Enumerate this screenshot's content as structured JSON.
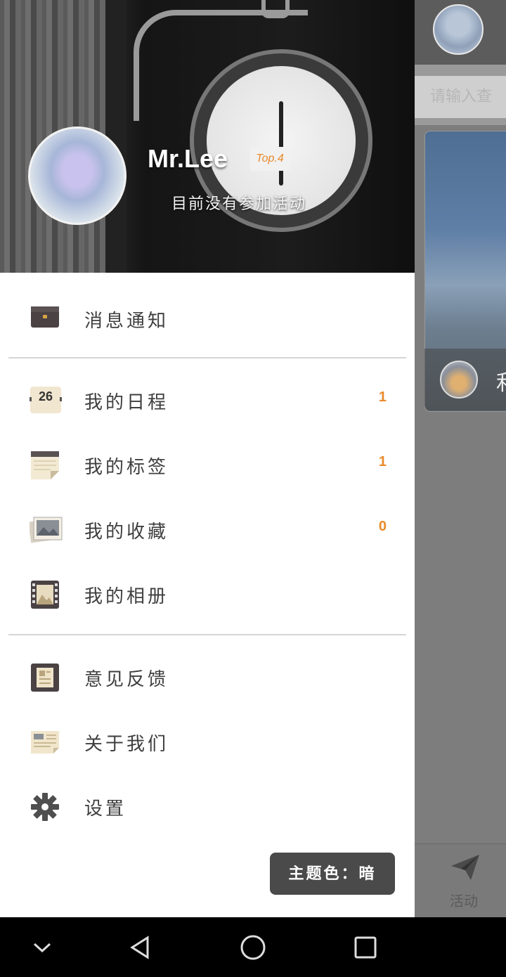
{
  "profile": {
    "username": "Mr.Lee",
    "rank_badge": "Top.4",
    "status": "目前没有参加活动"
  },
  "menu": {
    "section1": [
      {
        "label": "消息通知",
        "icon": "briefcase-icon"
      }
    ],
    "section2": [
      {
        "label": "我的日程",
        "icon": "calendar-icon",
        "calendar_day": "26",
        "count": "1"
      },
      {
        "label": "我的标签",
        "icon": "notepad-icon",
        "count": "1"
      },
      {
        "label": "我的收藏",
        "icon": "photos-icon",
        "count": "0"
      },
      {
        "label": "我的相册",
        "icon": "film-icon"
      }
    ],
    "section3": [
      {
        "label": "意见反馈",
        "icon": "feedback-icon"
      },
      {
        "label": "关于我们",
        "icon": "about-icon"
      },
      {
        "label": "设置",
        "icon": "gear-icon"
      }
    ]
  },
  "theme_button": "主题色：暗",
  "background": {
    "search_placeholder": "请输入查",
    "card_title_char": "利",
    "bottom_nav_label": "活动"
  },
  "colors": {
    "accent": "#e98a2b",
    "text": "#3e3e3e",
    "theme_button_bg": "#4a4a4a"
  }
}
